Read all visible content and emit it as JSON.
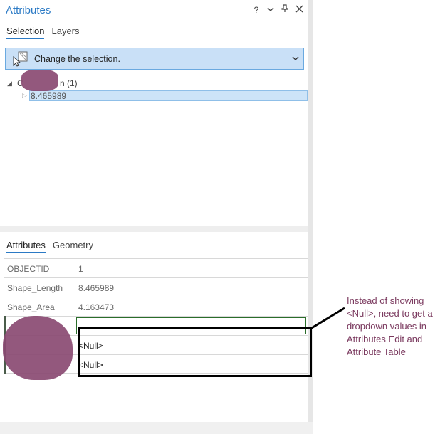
{
  "pane": {
    "title": "Attributes",
    "controls": {
      "help": "?",
      "menu": "⌄",
      "pin": "⊥",
      "close": "✕"
    }
  },
  "top_tabs": [
    {
      "label": "Selection"
    },
    {
      "label": "Layers"
    }
  ],
  "selection_dropdown": {
    "label": "Change the selection."
  },
  "tree": {
    "group_label_visible": "n (1)",
    "group_prefix_visible": "C",
    "selected_item": "8.465989"
  },
  "bottom_tabs": [
    {
      "label": "Attributes"
    },
    {
      "label": "Geometry"
    }
  ],
  "attributes": [
    {
      "name": "OBJECTID",
      "value": "1"
    },
    {
      "name": "Shape_Length",
      "value": "8.465989"
    },
    {
      "name": "Shape_Area",
      "value": "4.163473"
    },
    {
      "name": "",
      "value": ""
    },
    {
      "name": "",
      "value": "<Null>"
    },
    {
      "name": "",
      "value": "<Null>"
    }
  ],
  "annotation": {
    "note": "Instead of showing <Null>, need to get a dropdown values in Attributes Edit and Attribute Table"
  },
  "colors": {
    "accent": "#2b7ac5",
    "selection_bg": "#c9e0f7",
    "redaction": "#8a4a72",
    "note_text": "#7b3a5f",
    "edit_border": "#2a6d2a"
  }
}
